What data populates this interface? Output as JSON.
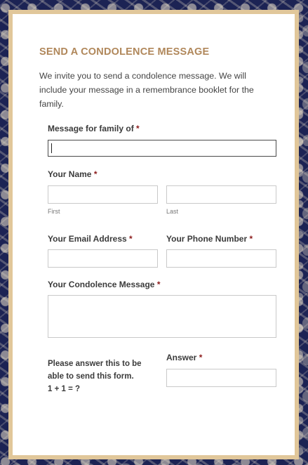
{
  "form": {
    "title": "SEND A CONDOLENCE MESSAGE",
    "intro": "We invite you to send a condolence message. We will include your message in a remembrance booklet for the family.",
    "required_marker": "*",
    "family": {
      "label": "Message for family of",
      "value": ""
    },
    "name": {
      "label": "Your Name",
      "first_sublabel": "First",
      "last_sublabel": "Last",
      "first_value": "",
      "last_value": ""
    },
    "email": {
      "label": "Your Email Address",
      "value": ""
    },
    "phone": {
      "label": "Your Phone Number",
      "value": ""
    },
    "message": {
      "label": "Your Condolence Message",
      "value": ""
    },
    "captcha": {
      "question_line1": "Please answer this to be able to send this form.",
      "question_line2": "1 + 1 = ?",
      "answer_label": "Answer",
      "answer_value": ""
    }
  },
  "colors": {
    "background": "#1c2354",
    "frame": "#e1c79a",
    "title": "#b0875a",
    "required": "#8c1b1b"
  }
}
